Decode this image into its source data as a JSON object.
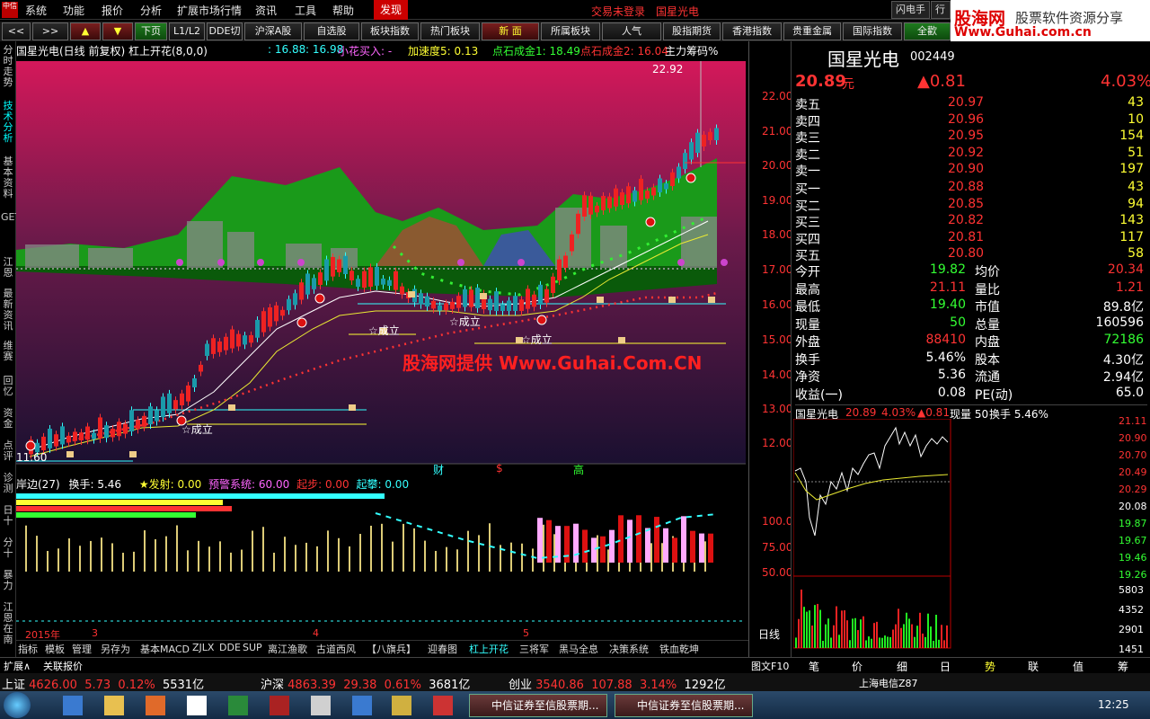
{
  "menu": {
    "items": [
      "系统",
      "功能",
      "报价",
      "分析",
      "扩展市场行情",
      "资讯",
      "工具",
      "帮助"
    ],
    "discover": "发现",
    "login": "交易未登录",
    "stock_name": "国星光电",
    "right_buttons": [
      "闪电手",
      "行情"
    ]
  },
  "ad": {
    "brand": "股海网",
    "slogan": "股票软件资源分享",
    "url": "Www.Guhai.com.cn"
  },
  "toolbar": [
    "<<",
    ">>",
    "▲",
    "▼",
    "下页",
    "L1/L2",
    "DDE切",
    "沪深A股",
    "自选股",
    "板块指数",
    "热门板块",
    "新 面",
    "所属板块",
    "人气",
    "股指期货",
    "香港指数",
    "贵重金属",
    "国际指数",
    "全歡"
  ],
  "left_tabs": [
    "分时走势",
    "技术分析",
    "基本资料",
    "GET",
    "江恩",
    "最新资讯",
    "维赛",
    "回忆",
    "资金",
    "点评",
    "诊测",
    "日十",
    "分十",
    "暴力",
    "江恩在南"
  ],
  "chart": {
    "title": "国星光电(日线 前复权) 杠上开花(8,0,0)",
    "params": [
      {
        "t": ": 16.88",
        ":c": "c"
      },
      {
        "t": ": 16.98",
        "c": "c"
      },
      {
        "t": "小花买入: -",
        "c": "m"
      },
      {
        "t": "加速度5: 0.13",
        "c": "y"
      },
      {
        "t": "点石成金1: 18.49",
        "c": "g"
      },
      {
        "t": "点石成金2: 16.04",
        "c": "r"
      },
      {
        "t": "主力筹码%",
        "c": "w"
      }
    ],
    "price_axis": [
      "22.00",
      "21.00",
      "20.00",
      "19.00",
      "18.00",
      "17.00",
      "16.00",
      "15.00",
      "14.00",
      "13.00",
      "12.00"
    ],
    "high_label": "22.92",
    "low_label": "11.60",
    "markers": [
      "☆成立",
      "☆成立",
      "☆成立",
      "☆成立"
    ],
    "tags": [
      "财",
      "$",
      "高"
    ],
    "watermark": "股海网提供 Www.Guhai.Com.CN"
  },
  "sub": {
    "title": "岸边(27)",
    "turn": "换手: 5.46",
    "fire": "★发射: 0.00",
    "warn": "预警系统: 60.00",
    "start": "起步: 0.00",
    "jump": "起攀: 0.00",
    "axis": [
      "100.0",
      "75.00",
      "50.00"
    ],
    "date_labels": [
      "2015年",
      "3",
      "4",
      "5"
    ],
    "period": "日线"
  },
  "bottom_tabs": [
    "指标",
    "模板",
    "管理",
    "另存为",
    "基本MACD",
    "ZJLX",
    "DDE",
    "SUP",
    "离江渔歌",
    "古道西风",
    "【八旗兵】",
    "迎春图",
    "杠上开花",
    "三将军",
    "黑马全息",
    "决策系统",
    "铁血乾坤"
  ],
  "status_left": [
    "扩展∧",
    "关联报价"
  ],
  "quote": {
    "name": "国星光电",
    "code": "002449",
    "price": "20.89",
    "unit": "元",
    "change": "▲0.81",
    "pct": "4.03%",
    "asks": [
      {
        "l": "卖五",
        "p": "20.97",
        "v": "43"
      },
      {
        "l": "卖四",
        "p": "20.96",
        "v": "10"
      },
      {
        "l": "卖三",
        "p": "20.95",
        "v": "154"
      },
      {
        "l": "卖二",
        "p": "20.92",
        "v": "51"
      },
      {
        "l": "卖一",
        "p": "20.90",
        "v": "197"
      }
    ],
    "bids": [
      {
        "l": "买一",
        "p": "20.88",
        "v": "43"
      },
      {
        "l": "买二",
        "p": "20.85",
        "v": "94"
      },
      {
        "l": "买三",
        "p": "20.82",
        "v": "143"
      },
      {
        "l": "买四",
        "p": "20.81",
        "v": "117"
      },
      {
        "l": "买五",
        "p": "20.80",
        "v": "58"
      }
    ],
    "stats": [
      {
        "a": "今开",
        "av": "19.82",
        "ac": "g",
        "b": "均价",
        "bv": "20.34",
        "bc": "r"
      },
      {
        "a": "最高",
        "av": "21.11",
        "ac": "r",
        "b": "量比",
        "bv": "1.21",
        "bc": "r"
      },
      {
        "a": "最低",
        "av": "19.40",
        "ac": "g",
        "b": "市值",
        "bv": "89.8亿",
        "bc": "w"
      },
      {
        "a": "现量",
        "av": "50",
        "ac": "g",
        "b": "总量",
        "bv": "160596",
        "bc": "w"
      },
      {
        "a": "外盘",
        "av": "88410",
        "ac": "r",
        "b": "内盘",
        "bv": "72186",
        "bc": "g"
      },
      {
        "a": "换手",
        "av": "5.46%",
        "ac": "w",
        "b": "股本",
        "bv": "4.30亿",
        "bc": "w"
      },
      {
        "a": "净资",
        "av": "5.36",
        "ac": "w",
        "b": "流通",
        "bv": "2.94亿",
        "bc": "w"
      },
      {
        "a": "收益(一)",
        "av": "0.08",
        "ac": "w",
        "b": "PE(动)",
        "bv": "65.0",
        "bc": "w"
      }
    ],
    "mini": {
      "name": "国星光电",
      "price": "20.89",
      "pct": "4.03%",
      "chg": "▲0.81",
      "vol": "现量 50",
      "turn": "换手 5.46%"
    },
    "mini_axis_up": [
      "21.11",
      "20.90",
      "20.70",
      "20.49",
      "20.29"
    ],
    "mini_base": "20.08",
    "mini_axis_dn": [
      "19.87",
      "19.67",
      "19.46",
      "19.26"
    ],
    "vol_axis": [
      "5803",
      "4352",
      "2901",
      "1451"
    ],
    "tabs": [
      "笔",
      "价",
      "细",
      "日",
      "势",
      "联",
      "值",
      "筹"
    ],
    "f10": "图文F10"
  },
  "index": [
    {
      "n": "上证",
      "v": "4626.00",
      "c": "5.73",
      "p": "0.12%",
      "a": "5531亿"
    },
    {
      "n": "沪深",
      "v": "4863.39",
      "c": "29.38",
      "p": "0.61%",
      "a": "3681亿"
    },
    {
      "n": "创业",
      "v": "3540.86",
      "c": "107.88",
      "p": "3.14%",
      "a": "1292亿"
    }
  ],
  "index_right": "上海电信Z87",
  "taskbar": {
    "tasks": [
      "中信证券至信股票期...",
      "中信证券至信股票期..."
    ],
    "clock": "12:25"
  }
}
